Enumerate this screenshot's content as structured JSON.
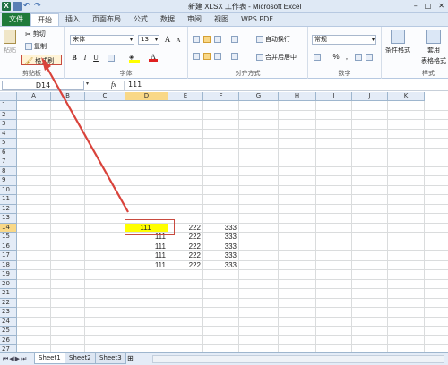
{
  "title_bar": {
    "app_icon": "X",
    "title": "新建 XLSX 工作表 - Microsoft Excel",
    "controls": [
      "–",
      "□",
      "✕"
    ]
  },
  "tabs": [
    {
      "label": "文件"
    },
    {
      "label": "开始"
    },
    {
      "label": "插入"
    },
    {
      "label": "页面布局"
    },
    {
      "label": "公式"
    },
    {
      "label": "数据"
    },
    {
      "label": "审阅"
    },
    {
      "label": "视图"
    },
    {
      "label": "WPS PDF"
    }
  ],
  "ribbon": {
    "clipboard": {
      "paste": "粘贴",
      "cut": "剪切",
      "copy": "复制",
      "format_painter": "格式刷",
      "label": "剪贴板"
    },
    "font": {
      "name": "宋体",
      "size": "13",
      "bold": "B",
      "italic": "I",
      "underline": "U",
      "grow": "A",
      "shrink": "A",
      "font_color": "A",
      "label": "字体"
    },
    "alignment": {
      "wrap": "自动换行",
      "merge": "合并后居中",
      "label": "对齐方式"
    },
    "number": {
      "format": "常规",
      "percent": "%",
      "comma": ",",
      "label": "数字"
    },
    "styles": {
      "conditional": "条件格式",
      "table": "套用",
      "table2": "表格格式",
      "label": "样式"
    }
  },
  "formula_bar": {
    "name_box": "D14",
    "fx": "fx",
    "content": "111"
  },
  "grid": {
    "columns": [
      "A",
      "B",
      "C",
      "D",
      "E",
      "F",
      "G",
      "H",
      "I",
      "J",
      "K"
    ],
    "rows": [
      "1",
      "2",
      "3",
      "4",
      "5",
      "6",
      "7",
      "8",
      "9",
      "10",
      "11",
      "12",
      "13",
      "14",
      "15",
      "16",
      "17",
      "18",
      "19",
      "20",
      "21",
      "22",
      "23",
      "24",
      "25",
      "26",
      "27",
      "28"
    ],
    "cells": [
      {
        "col": "D",
        "row": 14,
        "value": "111",
        "fill": "#ffff00"
      },
      {
        "col": "E",
        "row": 14,
        "value": "222"
      },
      {
        "col": "F",
        "row": 14,
        "value": "333"
      },
      {
        "col": "D",
        "row": 15,
        "value": "111"
      },
      {
        "col": "E",
        "row": 15,
        "value": "222"
      },
      {
        "col": "F",
        "row": 15,
        "value": "333"
      },
      {
        "col": "D",
        "row": 16,
        "value": "111"
      },
      {
        "col": "E",
        "row": 16,
        "value": "222"
      },
      {
        "col": "F",
        "row": 16,
        "value": "333"
      },
      {
        "col": "D",
        "row": 17,
        "value": "111"
      },
      {
        "col": "E",
        "row": 17,
        "value": "222"
      },
      {
        "col": "F",
        "row": 17,
        "value": "333"
      },
      {
        "col": "D",
        "row": 18,
        "value": "111"
      },
      {
        "col": "E",
        "row": 18,
        "value": "222"
      },
      {
        "col": "F",
        "row": 18,
        "value": "333"
      }
    ],
    "selected": {
      "col": "D",
      "row": 14
    }
  },
  "sheet_tabs": [
    {
      "label": "Sheet1",
      "active": true
    },
    {
      "label": "Sheet2",
      "active": false
    },
    {
      "label": "Sheet3",
      "active": false
    }
  ],
  "colors": {
    "file_tab": "#1f7a3a",
    "highlight": "#ffff00",
    "annotation": "#d9433b"
  }
}
